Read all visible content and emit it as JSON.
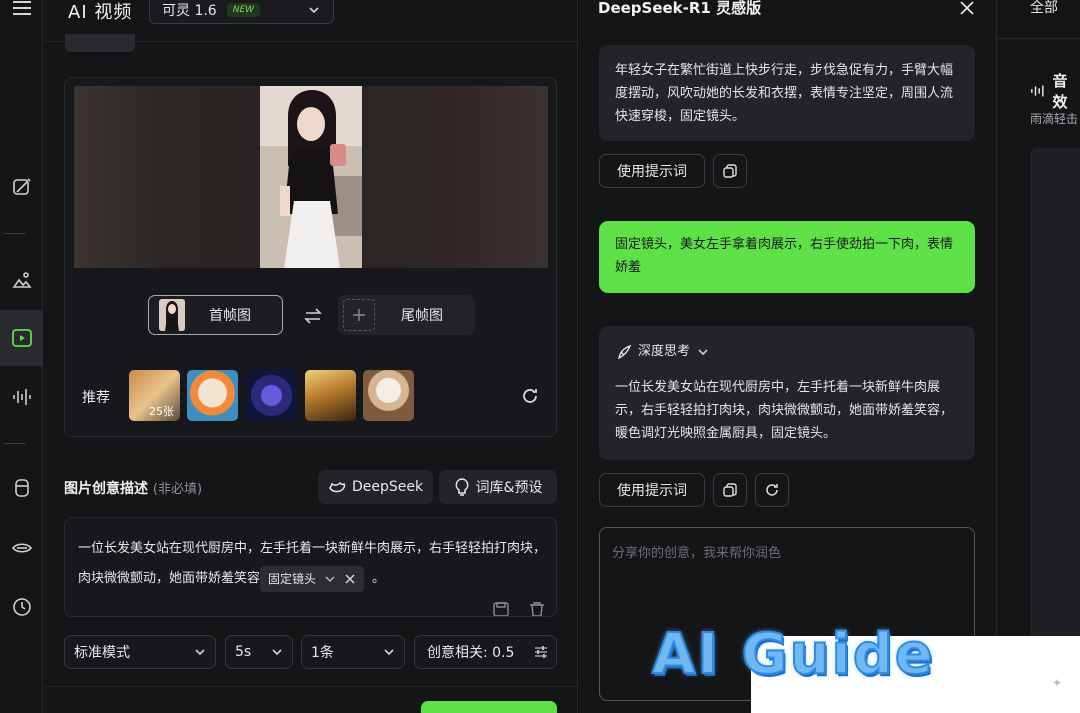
{
  "left_panel": {
    "app_title": "AI 视频",
    "model": {
      "value": "可灵 1.6",
      "badge": "NEW"
    },
    "first_frame_label": "首帧图",
    "last_frame_label": "尾帧图",
    "recommend_label": "推荐",
    "recommend_count": "25张",
    "section_title": "图片创意描述",
    "section_optional": "(非必填)",
    "deepseek_button": "DeepSeek",
    "presets_button": "词库&预设",
    "description_text": "一位长发美女站在现代厨房中，左手托着一块新鲜牛肉展示，右手轻轻拍打肉块，肉块微微颤动，她面带娇羞笑容",
    "description_tag": "固定镜头",
    "description_end": "。",
    "mode_select": "标准模式",
    "duration_select": "5s",
    "count_select": "1条",
    "creativity_label": "创意相关: 0.5"
  },
  "chat_panel": {
    "title": "DeepSeek-R1 灵感版",
    "ai_message_1": "年轻女子在繁忙街道上快步行走，步伐急促有力，手臂大幅度摆动，风吹动她的长发和衣摆，表情专注坚定，周围人流快速穿梭，固定镜头。",
    "use_prompt_label": "使用提示词",
    "user_message": "固定镜头，美女左手拿着肉展示，右手使劲拍一下肉，表情娇羞",
    "deep_think_label": "深度思考",
    "ai_message_2": "一位长发美女站在现代厨房中，左手托着一块新鲜牛肉展示，右手轻轻拍打肉块，肉块微微颤动，她面带娇羞笑容，暖色调灯光映照金属厨具，固定镜头。",
    "input_placeholder": "分享你的创意，我来帮你润色"
  },
  "right_panel": {
    "tab_all": "全部",
    "section_title": "音效",
    "subtitle": "雨滴轻击"
  },
  "watermark": {
    "text": "AI Guide"
  },
  "colors": {
    "accent": "#5ee047",
    "background": "#141517",
    "card": "#232428"
  }
}
